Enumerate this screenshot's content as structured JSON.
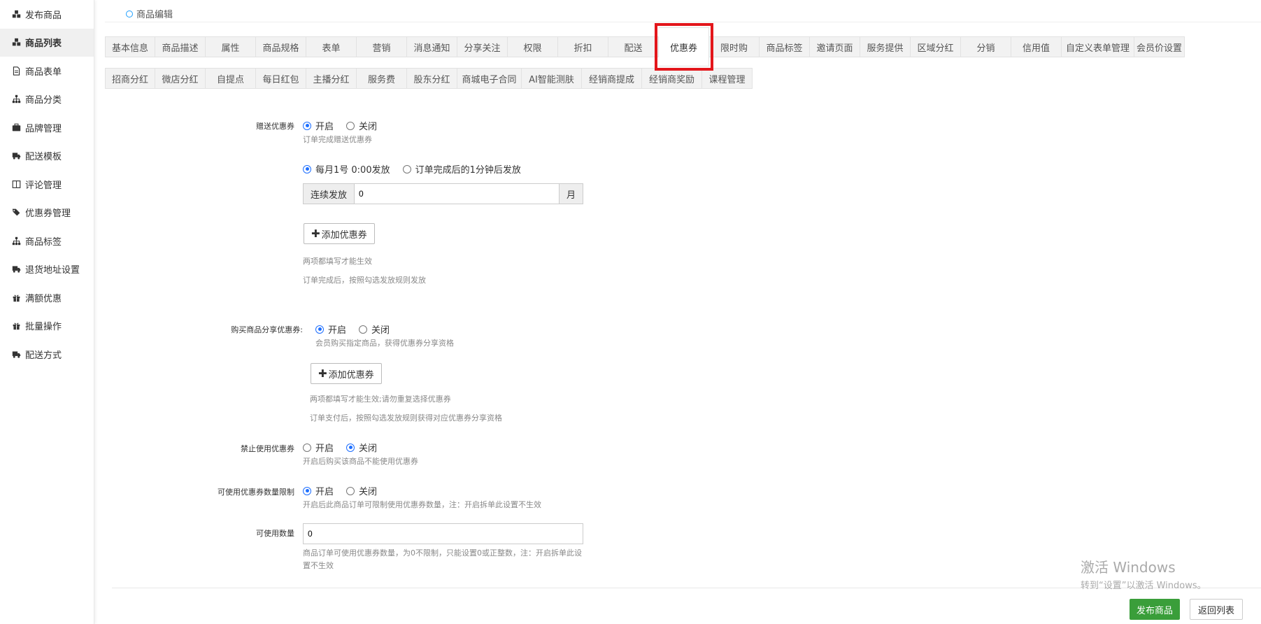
{
  "sidebar": {
    "items": [
      {
        "label": "发布商品",
        "icon": "cubes-icon"
      },
      {
        "label": "商品列表",
        "icon": "cubes-icon",
        "active": true
      },
      {
        "label": "商品表单",
        "icon": "form-icon"
      },
      {
        "label": "商品分类",
        "icon": "sitemap-icon"
      },
      {
        "label": "品牌管理",
        "icon": "briefcase-icon"
      },
      {
        "label": "配送模板",
        "icon": "truck-icon"
      },
      {
        "label": "评论管理",
        "icon": "columns-icon"
      },
      {
        "label": "优惠券管理",
        "icon": "tags-icon"
      },
      {
        "label": "商品标签",
        "icon": "sitemap-icon"
      },
      {
        "label": "退货地址设置",
        "icon": "truck-icon"
      },
      {
        "label": "满额优惠",
        "icon": "gift-icon"
      },
      {
        "label": "批量操作",
        "icon": "gift-icon"
      },
      {
        "label": "配送方式",
        "icon": "truck-icon"
      }
    ]
  },
  "breadcrumb": {
    "label": "商品编辑"
  },
  "tabs_row1": [
    "基本信息",
    "商品描述",
    "属性",
    "商品规格",
    "表单",
    "营销",
    "消息通知",
    "分享关注",
    "权限",
    "折扣",
    "配送",
    "优惠券",
    "限时购",
    "商品标签",
    "邀请页面",
    "服务提供",
    "区域分红",
    "分销",
    "信用值",
    "自定义表单管理",
    "会员价设置"
  ],
  "tabs_row2": [
    "招商分红",
    "微店分红",
    "自提点",
    "每日红包",
    "主播分红",
    "服务费",
    "股东分红",
    "商城电子合同",
    "AI智能测肤",
    "经销商提成",
    "经销商奖励",
    "课程管理"
  ],
  "active_tab": "优惠券",
  "form": {
    "gift_coupon": {
      "label": "赠送优惠券",
      "on": "开启",
      "off": "关闭",
      "hint": "订单完成赠送优惠券",
      "schedule_opt1": "每月1号 0:00发放",
      "schedule_opt2": "订单完成后的1分钟后发放",
      "continuous_label": "连续发放",
      "continuous_value": "0",
      "continuous_unit": "月",
      "add_button": "添加优惠券",
      "note1": "两项都填写才能生效",
      "note2": "订单完成后，按照勾选发放规则发放"
    },
    "share_coupon": {
      "label": "购买商品分享优惠券:",
      "on": "开启",
      "off": "关闭",
      "hint": "会员购买指定商品，获得优惠券分享资格",
      "add_button": "添加优惠券",
      "note1": "两项都填写才能生效;请勿重复选择优惠券",
      "note2": "订单支付后，按照勾选发放规则获得对应优惠券分享资格"
    },
    "forbid_coupon": {
      "label": "禁止使用优惠券",
      "on": "开启",
      "off": "关闭",
      "hint": "开启后购买该商品不能使用优惠券"
    },
    "limit_coupon": {
      "label": "可使用优惠券数量限制",
      "on": "开启",
      "off": "关闭",
      "hint": "开启后此商品订单可限制使用优惠券数量，注：开启拆单此设置不生效"
    },
    "usable_count": {
      "label": "可使用数量",
      "value": "0",
      "hint_line1": "商品订单可使用优惠券数量，为0不限制，只能设置0或正整数，注：开启拆单此设",
      "hint_line2": "置不生效"
    }
  },
  "footer": {
    "publish": "发布商品",
    "back": "返回列表"
  },
  "watermark": {
    "line1": "激活 Windows",
    "line2": "转到“设置”以激活 Windows。"
  }
}
